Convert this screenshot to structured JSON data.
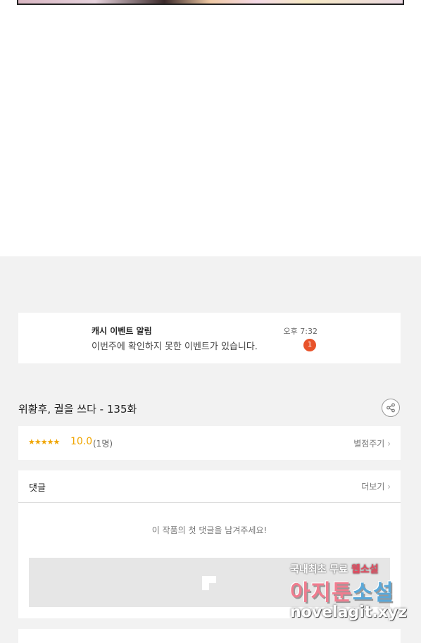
{
  "notification": {
    "title": "캐시 이벤트 알림",
    "message": "이번주에 확인하지 못한 이벤트가 있습니다.",
    "time": "오후 7:32",
    "badge": "1"
  },
  "episode": {
    "title": "위황후, 궐을 쓰다 - 135화"
  },
  "rating": {
    "stars": "★★★★★",
    "score": "10.0",
    "count": "(1명)",
    "rate_label": "별점주기",
    "value": 10.0,
    "max": 10
  },
  "comments": {
    "label": "댓글",
    "more_label": "더보기",
    "empty_text": "이 작품의 첫 댓글을 남겨주세요!"
  },
  "watermark": {
    "line1_a": "국내최초 무료",
    "line1_b": "웹소설",
    "line2_a": "아지툰",
    "line2_b": "소설",
    "line3": "novelagit.xyz"
  },
  "colors": {
    "accent": "#f0a500",
    "badge": "#e8532a",
    "background": "#f2f2f2"
  },
  "icons": {
    "share": "share-icon",
    "chevron": "chevron-right-icon",
    "ad_placeholder": "image-placeholder-icon"
  }
}
